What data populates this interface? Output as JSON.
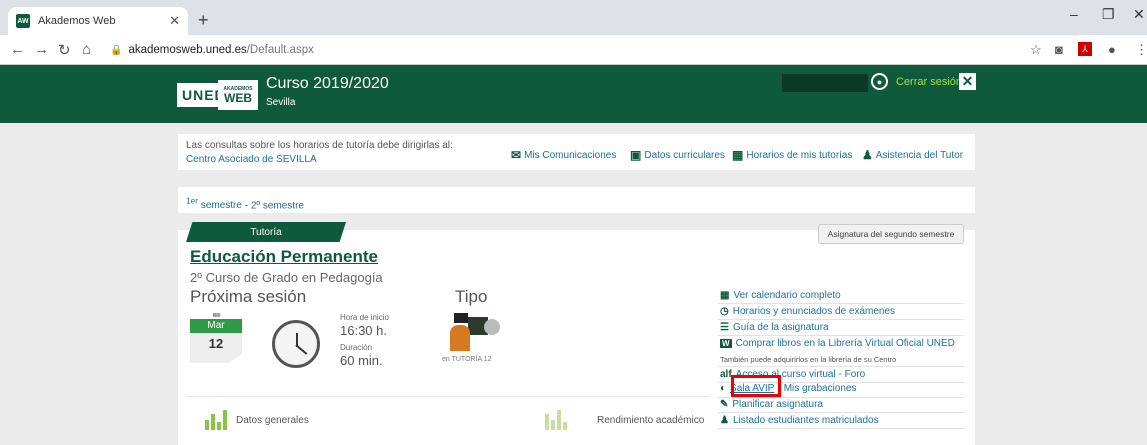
{
  "browser": {
    "tab_title": "Akademos Web",
    "tab_favicon": "AW",
    "url_host": "akademosweb.uned.es",
    "url_path": "/Default.aspx"
  },
  "header": {
    "logo_uned": "UNED",
    "logo_small": "AKADEMOS",
    "logo_web": "WEB",
    "course_title": "Curso 2019/2020",
    "city": "Sevilla",
    "logout": "Cerrar sesión"
  },
  "info": {
    "text": "Las consultas sobre los horarios de tutoría debe dirigirlas al:",
    "center_link": "Centro Asociado de SEVILLA",
    "links": [
      "Mis Comunicaciones",
      "Datos curriculares",
      "Horarios de mis tutorías",
      "Asistencia del Tutor"
    ]
  },
  "semesters": {
    "first_sup": "1er",
    "first": " semestre",
    "sep": " - ",
    "second": "2º semestre"
  },
  "subject": {
    "tab": "Tutoría",
    "second_semester_btn": "Asignatura del segundo semestre",
    "title": "Educación Permanente",
    "subtitle": "2º Curso de Grado en Pedagogía",
    "next_session": "Próxima sesión",
    "type_label": "Tipo",
    "cal_month": "Mar",
    "cal_day": "12",
    "start_label": "Hora de inicio",
    "start_value": "16:30 h.",
    "duration_label": "Duración",
    "duration_value": "60 min.",
    "tutor_caption": "en TUTORÍA 12"
  },
  "right_links": {
    "calendar": "Ver calendario completo",
    "schedules": "Horarios y enunciados de exámenes",
    "guide": "Guía de la asignatura",
    "books": "Comprar libros en la Librería Virtual Oficial UNED",
    "books_note": "También puede adquirirlos en la librería de su Centro",
    "virtual": "Acceso al curso virtual - Foro",
    "sala_avip": "Sala AVIP",
    "recordings": "Mis grabaciones",
    "plan": "Planificar asignatura",
    "students": "Listado estudiantes matriculados"
  },
  "bottom": {
    "general": "Datos generales",
    "performance": "Rendimiento académico"
  }
}
